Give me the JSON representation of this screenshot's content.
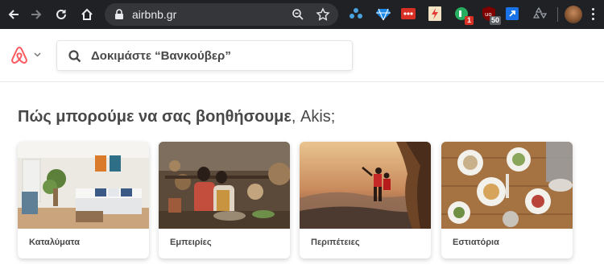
{
  "browser": {
    "url": "airbnb.gr",
    "extensions": [
      {
        "icon": "dropbox-share-icon"
      },
      {
        "icon": "diamond-icon"
      },
      {
        "icon": "dots-grid-icon"
      },
      {
        "icon": "lightning-icon"
      },
      {
        "icon": "ghostery-icon",
        "badge": "1"
      },
      {
        "icon": "ublock-icon",
        "badge": "50"
      },
      {
        "icon": "external-link-icon"
      },
      {
        "icon": "recycle-icon"
      }
    ]
  },
  "header": {
    "search_placeholder": "Δοκιμάστε “Βανκούβερ”"
  },
  "main": {
    "heading_bold": "Πώς μπορούμε να σας βοηθήσουμε",
    "heading_name": ", Akis;",
    "cards": [
      {
        "label": "Καταλύματα"
      },
      {
        "label": "Εμπειρίες"
      },
      {
        "label": "Περιπέτειες"
      },
      {
        "label": "Εστιατόρια"
      }
    ]
  },
  "colors": {
    "brand": "#FF5A5F",
    "text": "#484848",
    "toolbar": "#202124"
  }
}
